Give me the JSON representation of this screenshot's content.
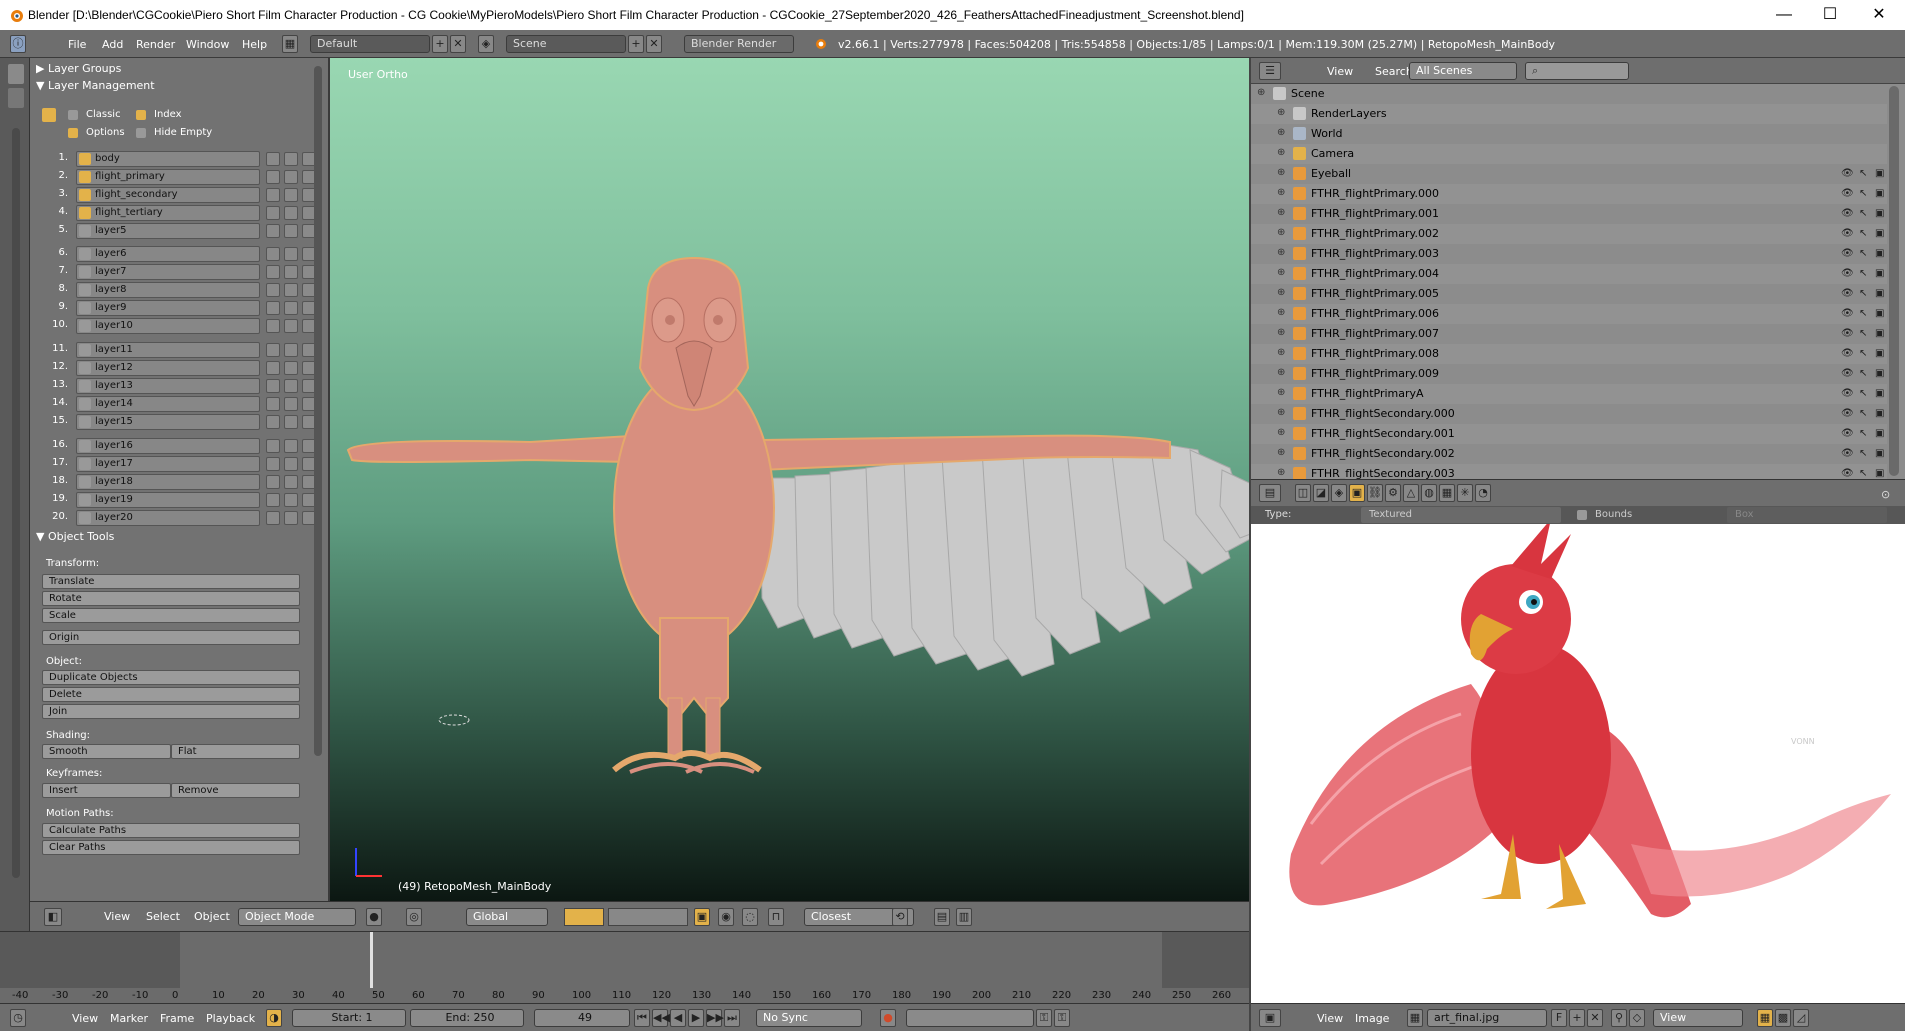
{
  "window": {
    "title": "Blender [D:\\Blender\\CGCookie\\Piero Short Film Character Production - CG Cookie\\MyPieroModels\\Piero Short Film Character Production - CGCookie_27September2020_426_FeathersAttachedFineadjustment_Screenshot.blend]",
    "minimize": "—",
    "maximize": "☐",
    "close": "✕"
  },
  "info_header": {
    "menus": [
      "File",
      "Add",
      "Render",
      "Window",
      "Help"
    ],
    "screen_layout": "Default",
    "scene": "Scene",
    "render_engine": "Blender Render",
    "stats": "v2.66.1 | Verts:277978 | Faces:504208 | Tris:554858 | Objects:1/85 | Lamps:0/1 | Mem:119.30M (25.27M) | RetopoMesh_MainBody"
  },
  "left_panel": {
    "layer_groups": "Layer Groups",
    "layer_management": "Layer Management",
    "opt_classic": "Classic",
    "opt_index": "Index",
    "opt_options": "Options",
    "opt_hide_empty": "Hide Empty",
    "layers": [
      {
        "num": "1.",
        "name": "body",
        "visible": true
      },
      {
        "num": "2.",
        "name": "flight_primary",
        "visible": true
      },
      {
        "num": "3.",
        "name": "flight_secondary",
        "visible": true
      },
      {
        "num": "4.",
        "name": "flight_tertiary",
        "visible": true
      },
      {
        "num": "5.",
        "name": "layer5",
        "visible": false
      },
      {
        "num": "6.",
        "name": "layer6",
        "visible": false
      },
      {
        "num": "7.",
        "name": "layer7",
        "visible": false
      },
      {
        "num": "8.",
        "name": "layer8",
        "visible": false
      },
      {
        "num": "9.",
        "name": "layer9",
        "visible": false
      },
      {
        "num": "10.",
        "name": "layer10",
        "visible": false
      },
      {
        "num": "11.",
        "name": "layer11",
        "visible": false
      },
      {
        "num": "12.",
        "name": "layer12",
        "visible": false
      },
      {
        "num": "13.",
        "name": "layer13",
        "visible": false
      },
      {
        "num": "14.",
        "name": "layer14",
        "visible": false
      },
      {
        "num": "15.",
        "name": "layer15",
        "visible": false
      },
      {
        "num": "16.",
        "name": "layer16",
        "visible": false
      },
      {
        "num": "17.",
        "name": "layer17",
        "visible": false
      },
      {
        "num": "18.",
        "name": "layer18",
        "visible": false
      },
      {
        "num": "19.",
        "name": "layer19",
        "visible": false
      },
      {
        "num": "20.",
        "name": "layer20",
        "visible": false
      }
    ],
    "object_tools": "Object Tools",
    "transform_label": "Transform:",
    "translate": "Translate",
    "rotate": "Rotate",
    "scale": "Scale",
    "origin": "Origin",
    "object_label": "Object:",
    "duplicate": "Duplicate Objects",
    "delete": "Delete",
    "join": "Join",
    "shading_label": "Shading:",
    "smooth": "Smooth",
    "flat": "Flat",
    "keyframes_label": "Keyframes:",
    "insert": "Insert",
    "remove": "Remove",
    "motion_label": "Motion Paths:",
    "calc_paths": "Calculate Paths",
    "clear_paths": "Clear Paths"
  },
  "viewport": {
    "view_name": "User Ortho",
    "object_label": "(49) RetopoMesh_MainBody",
    "header": {
      "view": "View",
      "select": "Select",
      "object": "Object",
      "mode": "Object Mode",
      "orientation": "Global",
      "snap": "Closest"
    }
  },
  "timeline": {
    "ticks": [
      "-40",
      "-30",
      "-20",
      "-10",
      "0",
      "10",
      "20",
      "30",
      "40",
      "50",
      "60",
      "70",
      "80",
      "90",
      "100",
      "110",
      "120",
      "130",
      "140",
      "150",
      "160",
      "170",
      "180",
      "190",
      "200",
      "210",
      "220",
      "230",
      "240",
      "250",
      "260"
    ],
    "view": "View",
    "marker": "Marker",
    "frame": "Frame",
    "playback": "Playback",
    "start": "Start: 1",
    "end": "End: 250",
    "current": "49",
    "sync": "No Sync"
  },
  "outliner": {
    "view": "View",
    "search": "Search",
    "filter": "All Scenes",
    "items": [
      {
        "name": "Scene",
        "indent": 0,
        "icon": "scene-icon"
      },
      {
        "name": "RenderLayers",
        "indent": 1,
        "icon": "renderlayers-icon"
      },
      {
        "name": "World",
        "indent": 1,
        "icon": "world-icon"
      },
      {
        "name": "Camera",
        "indent": 1,
        "icon": "camera-icon"
      },
      {
        "name": "Eyeball",
        "indent": 1,
        "icon": "mesh-icon"
      },
      {
        "name": "FTHR_flightPrimary.000",
        "indent": 1,
        "icon": "mesh-icon"
      },
      {
        "name": "FTHR_flightPrimary.001",
        "indent": 1,
        "icon": "mesh-icon"
      },
      {
        "name": "FTHR_flightPrimary.002",
        "indent": 1,
        "icon": "mesh-icon"
      },
      {
        "name": "FTHR_flightPrimary.003",
        "indent": 1,
        "icon": "mesh-icon"
      },
      {
        "name": "FTHR_flightPrimary.004",
        "indent": 1,
        "icon": "mesh-icon"
      },
      {
        "name": "FTHR_flightPrimary.005",
        "indent": 1,
        "icon": "mesh-icon"
      },
      {
        "name": "FTHR_flightPrimary.006",
        "indent": 1,
        "icon": "mesh-icon"
      },
      {
        "name": "FTHR_flightPrimary.007",
        "indent": 1,
        "icon": "mesh-icon"
      },
      {
        "name": "FTHR_flightPrimary.008",
        "indent": 1,
        "icon": "mesh-icon"
      },
      {
        "name": "FTHR_flightPrimary.009",
        "indent": 1,
        "icon": "mesh-icon"
      },
      {
        "name": "FTHR_flightPrimaryA",
        "indent": 1,
        "icon": "mesh-icon"
      },
      {
        "name": "FTHR_flightSecondary.000",
        "indent": 1,
        "icon": "mesh-icon"
      },
      {
        "name": "FTHR_flightSecondary.001",
        "indent": 1,
        "icon": "mesh-icon"
      },
      {
        "name": "FTHR_flightSecondary.002",
        "indent": 1,
        "icon": "mesh-icon"
      },
      {
        "name": "FTHR_flightSecondary.003",
        "indent": 1,
        "icon": "mesh-icon"
      }
    ]
  },
  "properties": {
    "type_label": "Type:",
    "type_value": "Textured",
    "bounds": "Bounds",
    "box": "Box"
  },
  "image_editor": {
    "view": "View",
    "image": "Image",
    "filename": "art_final.jpg",
    "f_flag": "F",
    "display": "View"
  },
  "colors": {
    "bird_body": "#d88f7f",
    "feathers": "#c7c7c7",
    "phoenix_red": "#d8353f",
    "accent": "#e3b24a"
  }
}
